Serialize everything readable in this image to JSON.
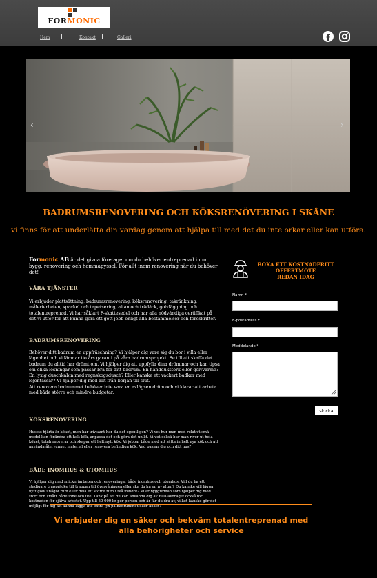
{
  "brand": {
    "logo_text_a": "FOR",
    "logo_text_b": "MONIC",
    "accent": "#ff8c1a"
  },
  "nav": {
    "items": [
      "Hem",
      "Kontakt",
      "Galleri"
    ]
  },
  "social": {
    "icons": [
      "facebook-icon",
      "instagram-icon"
    ]
  },
  "hero": {
    "left_arrow": "‹",
    "right_arrow": "›"
  },
  "headline": "BADRUMSRENOVERING OCH KÖKSRENÖVERING I SKÅNE",
  "subline": "vi finns för att underlätta din vardag genom att hjälpa till med det du inte orkar eller kan utföra.",
  "intro": {
    "brand_a": "For",
    "brand_b": "monic",
    "brand_c": " AB",
    "text": " är det givna företaget om du behöver entreprenad inom bygg, renovering och hemmapyssel. För allt inom renovering när du behöver det!"
  },
  "sections": [
    {
      "title": "VÅRA TJÄNSTER",
      "text": "Vi erbjuder plattsättning, badrumsrenovering, köksrenovering, takränkning, målerierbeten, spackel och tapetsering, altan och trädäck, golvläggning och totalentreprenad. Vi har såklart F-skattesedel och har alla nödvändiga certifikat på det vi utför för att kunna göra ett gott jobb enligt alla bestämmelser och föreskrifter."
    },
    {
      "title": "BADRUMSRENOVERING",
      "text": "Behöver ditt badrum en uppfräschning? Vi hjälper dig vare sig du bor i villa eller lägenhet och vi lämnar tio års garanti på våra badrumsprojekt. Se till att skaffa det badrum du alltid har drömt om. Vi hjälper dig att uppfylla dina drömmar och kan tipsa om olika lösningar som passar bra för ditt badrum. En handdukstork eller golvvärme? En lyxig duschkabin med regnskogsdusch? Eller kanske ett vackert badkar med lejontassar? Vi hjälper dig med allt från början till slut.\nAtt renovera badrummet behöver inte vara en avlägsen dröm och vi klarar att arbeta med både större och mindre budgetar."
    },
    {
      "title": "KÖKSRENOVERING",
      "text": "Husets hjärta är köket, men har trivsamt har du det egentligen? Vi vet hur man med relativt små medel kan förändra ett helt kök, anpassa det och göra det unikt. Vi vet också hur man river ut hela köket, totalrenoverar och skapar ett helt nytt kök. Vi jobbar både med att sätta in helt nya kök och att använda återvunnet material eller renovera befintliga kök. Vad passar dig och ditt hus?"
    },
    {
      "title": "BÅDE INOMHUS & UTOMHUS",
      "text": "Vi hjälper dig med snickeriarbeten och renoveringar både inomhus och utomhus. Vill du ha ett stadigare trappräcke till trappan till övervåningen eller ska du ha en ny altan? Du kanske vill lägga nytt golv i något rum eller dela ett större rum i två mindre? Vi är byggfirman som hjälper dig med stort och smått både inne och ute. Tänk på att du kan använda dig av ROT-avdraget också för kostnaden för själva arbetet. Upp till 50 000 kr per person och år får du dra av, vilket kanske gör det möjligt för dig att kunna lägga lite extra lyx på badrummet eller köket?"
    }
  ],
  "form": {
    "cta_line1": "BOKA ETT KOSTNADFRITT",
    "cta_line2": "OFFERTMÖTE",
    "cta_line3": "REDAN IDAG",
    "name_label": "Namn *",
    "email_label": "E-postadress *",
    "message_label": "Meddelande *",
    "submit_label": "skicka"
  },
  "closing": "Vi erbjuder dig en säker och bekväm totalentreprenad med  alla behörigheter och service"
}
